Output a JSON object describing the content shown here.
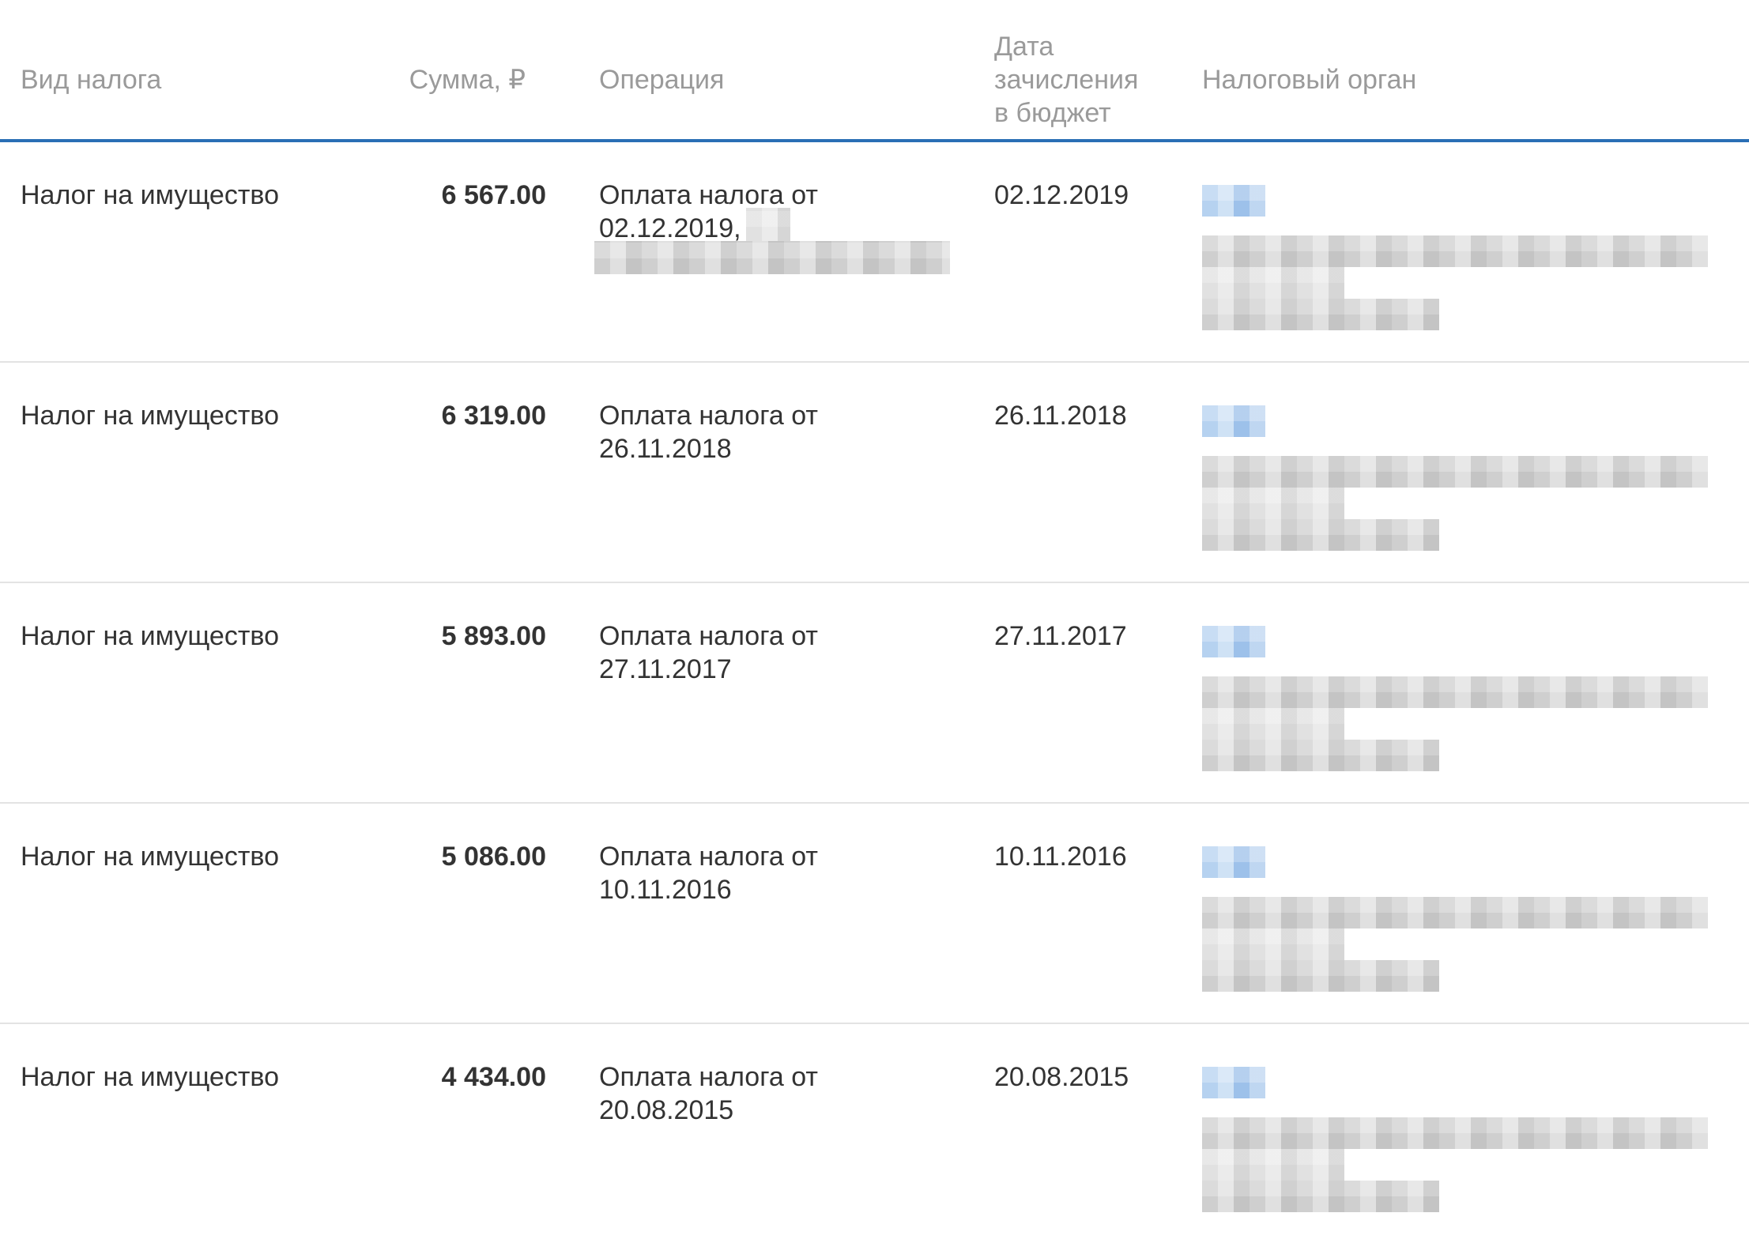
{
  "table": {
    "headers": {
      "type": "Вид налога",
      "sum": "Сумма, ₽",
      "operation": "Операция",
      "date_line1": "Дата",
      "date_line2": "зачисления",
      "date_line3": "в бюджет",
      "org": "Налоговый орган"
    },
    "rows": [
      {
        "type": "Налог на имущество",
        "sum": "6 567.00",
        "operation_line1": "Оплата налога от",
        "operation_line2": "02.12.2019,",
        "date": "02.12.2019"
      },
      {
        "type": "Налог на имущество",
        "sum": "6 319.00",
        "operation_line1": "Оплата налога от",
        "operation_line2": "26.11.2018",
        "date": "26.11.2018"
      },
      {
        "type": "Налог на имущество",
        "sum": "5 893.00",
        "operation_line1": "Оплата налога от",
        "operation_line2": "27.11.2017",
        "date": "27.11.2017"
      },
      {
        "type": "Налог на имущество",
        "sum": "5 086.00",
        "operation_line1": "Оплата налога от",
        "operation_line2": "10.11.2016",
        "date": "10.11.2016"
      },
      {
        "type": "Налог на имущество",
        "sum": "4 434.00",
        "operation_line1": "Оплата налога от",
        "operation_line2": "20.08.2015",
        "date": "20.08.2015"
      }
    ]
  },
  "colors": {
    "header_text": "#9a9a9a",
    "body_text": "#333333",
    "header_border": "#2a6fb5",
    "row_border": "#e3e3e3"
  }
}
